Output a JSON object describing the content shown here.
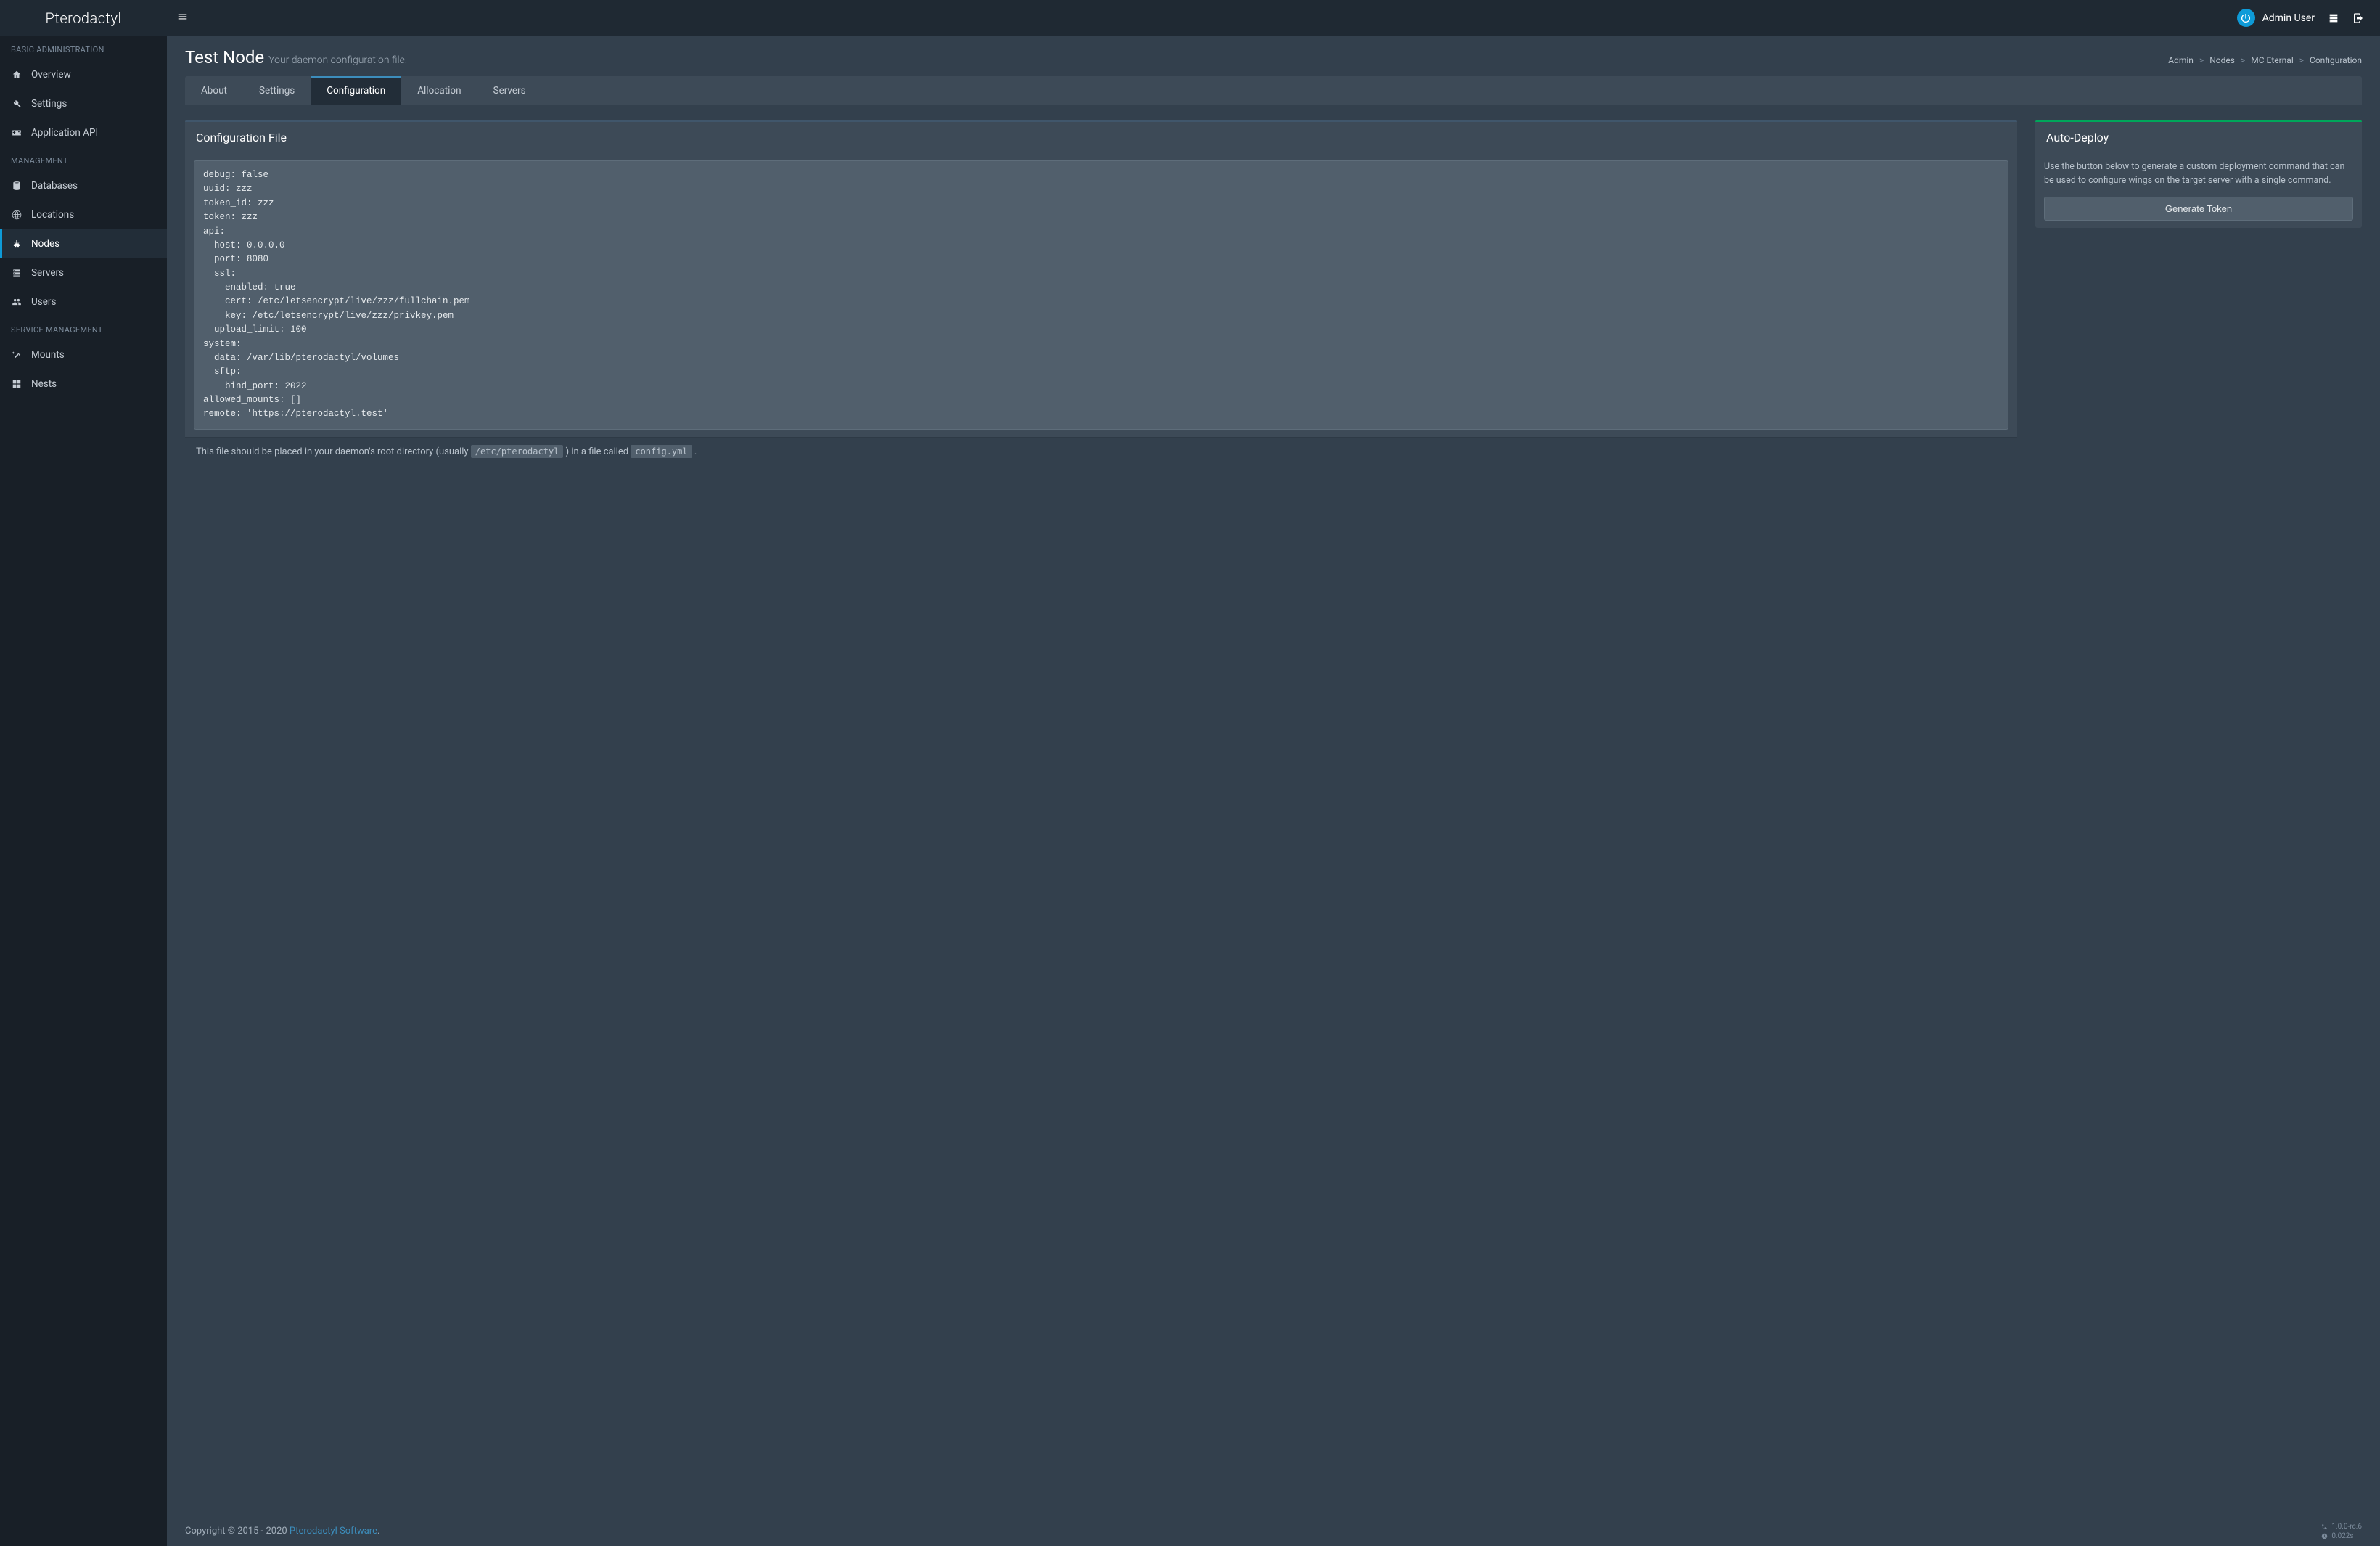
{
  "brand": "Pterodactyl",
  "user_name": "Admin User",
  "sidebar": {
    "sections": [
      {
        "header": "BASIC ADMINISTRATION",
        "items": [
          {
            "label": "Overview",
            "icon": "home"
          },
          {
            "label": "Settings",
            "icon": "wrench"
          },
          {
            "label": "Application API",
            "icon": "gamepad"
          }
        ]
      },
      {
        "header": "MANAGEMENT",
        "items": [
          {
            "label": "Databases",
            "icon": "database"
          },
          {
            "label": "Locations",
            "icon": "globe"
          },
          {
            "label": "Nodes",
            "icon": "sitemap",
            "active": true
          },
          {
            "label": "Servers",
            "icon": "server"
          },
          {
            "label": "Users",
            "icon": "users"
          }
        ]
      },
      {
        "header": "SERVICE MANAGEMENT",
        "items": [
          {
            "label": "Mounts",
            "icon": "magic"
          },
          {
            "label": "Nests",
            "icon": "grid"
          }
        ]
      }
    ]
  },
  "page": {
    "title": "Test Node",
    "subtitle": "Your daemon configuration file."
  },
  "breadcrumbs": [
    {
      "label": "Admin"
    },
    {
      "label": "Nodes"
    },
    {
      "label": "MC Eternal"
    },
    {
      "label": "Configuration"
    }
  ],
  "tabs": [
    {
      "label": "About"
    },
    {
      "label": "Settings"
    },
    {
      "label": "Configuration",
      "active": true
    },
    {
      "label": "Allocation"
    },
    {
      "label": "Servers"
    }
  ],
  "config_box": {
    "title": "Configuration File",
    "content": "debug: false\nuuid: zzz\ntoken_id: zzz\ntoken: zzz\napi:\n  host: 0.0.0.0\n  port: 8080\n  ssl:\n    enabled: true\n    cert: /etc/letsencrypt/live/zzz/fullchain.pem\n    key: /etc/letsencrypt/live/zzz/privkey.pem\n  upload_limit: 100\nsystem:\n  data: /var/lib/pterodactyl/volumes\n  sftp:\n    bind_port: 2022\nallowed_mounts: []\nremote: 'https://pterodactyl.test'",
    "footer_pre": "This file should be placed in your daemon's root directory (usually ",
    "footer_code1": "/etc/pterodactyl",
    "footer_mid": " ) in a file called ",
    "footer_code2": "config.yml",
    "footer_post": " ."
  },
  "deploy_box": {
    "title": "Auto-Deploy",
    "desc": "Use the button below to generate a custom deployment command that can be used to configure wings on the target server with a single command.",
    "button": "Generate Token"
  },
  "footer": {
    "copyright_pre": "Copyright © 2015 - 2020 ",
    "link": "Pterodactyl Software",
    "copyright_post": ".",
    "version": "1.0.0-rc.6",
    "time": "0.022s"
  }
}
